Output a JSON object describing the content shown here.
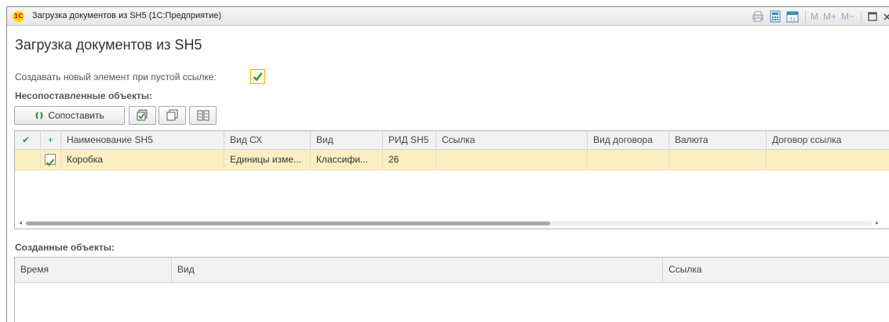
{
  "window": {
    "title": "Загрузка документов из SH5  (1С:Предприятие)",
    "logo_text": "1C",
    "toolbar_icons": [
      "printer-icon",
      "calculator-icon",
      "calendar-icon"
    ],
    "memory_buttons": {
      "m": "M",
      "m_plus": "M+",
      "m_minus": "M−"
    }
  },
  "form": {
    "title": "Загрузка документов из SH5",
    "create_new_label": "Создавать новый элемент при пустой ссылке:",
    "create_new_checked": true
  },
  "unmatched": {
    "section_title": "Несопоставленные объекты:",
    "toolbar": {
      "match_label": "Сопоставить",
      "icons": [
        "check-all-icon",
        "copy-icon",
        "toggle-icon"
      ]
    },
    "columns": {
      "check": "✔",
      "plus": "+",
      "name": "Наименование SH5",
      "vid_cx": "Вид СХ",
      "vid": "Вид",
      "rid": "РИД SH5",
      "link": "Ссылка",
      "contract_type": "Вид договора",
      "currency": "Валюта",
      "contract_link": "Договор ссылка"
    },
    "rows": [
      {
        "checked": true,
        "name": "Коробка",
        "vid_cx": "Единицы изме...",
        "vid": "Классифи...",
        "rid": "26",
        "link": "",
        "contract_type": "",
        "currency": "",
        "contract_link": ""
      }
    ],
    "hscroll_visible_fraction": 0.62
  },
  "created": {
    "section_title": "Созданные объекты:",
    "columns": {
      "time": "Время",
      "vid": "Вид",
      "link": "Ссылка"
    }
  },
  "colors": {
    "selected_row": "#fbefc1",
    "check_green": "#2f9a2f",
    "accent_yellow": "#e2b400"
  }
}
